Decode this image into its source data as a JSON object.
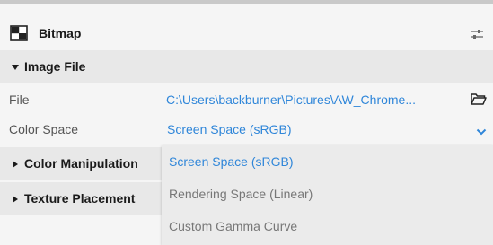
{
  "panel": {
    "title": "Bitmap"
  },
  "sections": {
    "image_file": {
      "label": "Image File",
      "file": {
        "label": "File",
        "value": "C:\\Users\\backburner\\Pictures\\AW_Chrome..."
      },
      "color_space": {
        "label": "Color Space",
        "value": "Screen Space (sRGB)"
      }
    },
    "color_manipulation": {
      "label": "Color Manipulation"
    },
    "texture_placement": {
      "label": "Texture Placement"
    }
  },
  "dropdown": {
    "options": [
      "Screen Space (sRGB)",
      "Rendering Space (Linear)",
      "Custom Gamma Curve"
    ]
  },
  "colors": {
    "accent": "#2f86d9",
    "section_bg": "#e8e8e8",
    "panel_bg": "#f5f5f5"
  },
  "icons": {
    "bitmap": "bitmap-icon",
    "settings": "sliders-icon",
    "folder": "folder-open-icon",
    "chevron": "chevron-down-icon"
  }
}
